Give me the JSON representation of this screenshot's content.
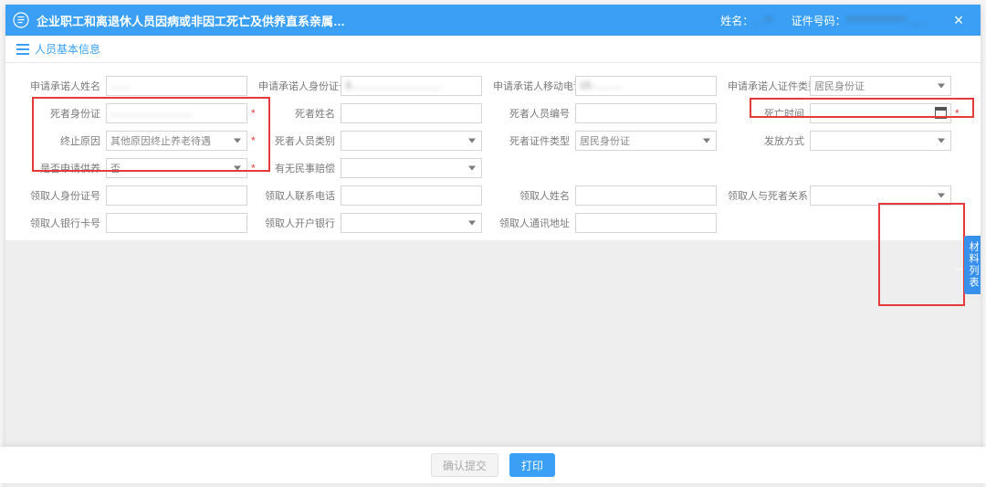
{
  "header": {
    "title": "企业职工和离退休人员因病或非因工死亡及供养直系亲属…",
    "name_label": "姓名：",
    "name_value": "…**",
    "id_label": "证件号码：",
    "id_value": "**************……"
  },
  "section": {
    "title": "人员基本信息"
  },
  "fields": {
    "r1c1": {
      "label": "申请承诺人姓名",
      "value": "……"
    },
    "r1c2": {
      "label": "申请承诺人身份证号",
      "value": "3………………………"
    },
    "r1c3": {
      "label": "申请承诺人移动电话",
      "value": "15………"
    },
    "r1c4": {
      "label": "申请承诺人证件类型",
      "value": "居民身份证"
    },
    "r2c1": {
      "label": "死者身份证",
      "value": "……………………"
    },
    "r2c2": {
      "label": "死者姓名",
      "value": ""
    },
    "r2c3": {
      "label": "死者人员编号",
      "value": ""
    },
    "r2c4": {
      "label": "死亡时间",
      "value": ""
    },
    "r3c1": {
      "label": "终止原因",
      "value": "其他原因终止养老待遇"
    },
    "r3c2": {
      "label": "死者人员类别",
      "value": ""
    },
    "r3c3": {
      "label": "死者证件类型",
      "value": "居民身份证"
    },
    "r3c4": {
      "label": "发放方式",
      "value": ""
    },
    "r4c1": {
      "label": "是否申请供养",
      "value": "否"
    },
    "r4c2": {
      "label": "有无民事赔偿",
      "value": ""
    },
    "r5c1": {
      "label": "领取人身份证号",
      "value": ""
    },
    "r5c2": {
      "label": "领取人联系电话",
      "value": ""
    },
    "r5c3": {
      "label": "领取人姓名",
      "value": ""
    },
    "r5c4": {
      "label": "领取人与死者关系",
      "value": ""
    },
    "r6c1": {
      "label": "领取人银行卡号",
      "value": ""
    },
    "r6c2": {
      "label": "领取人开户银行",
      "value": ""
    },
    "r6c3": {
      "label": "领取人通讯地址",
      "value": ""
    }
  },
  "side_tab": {
    "label": "材料列表"
  },
  "footer": {
    "confirm": "确认提交",
    "print": "打印"
  }
}
